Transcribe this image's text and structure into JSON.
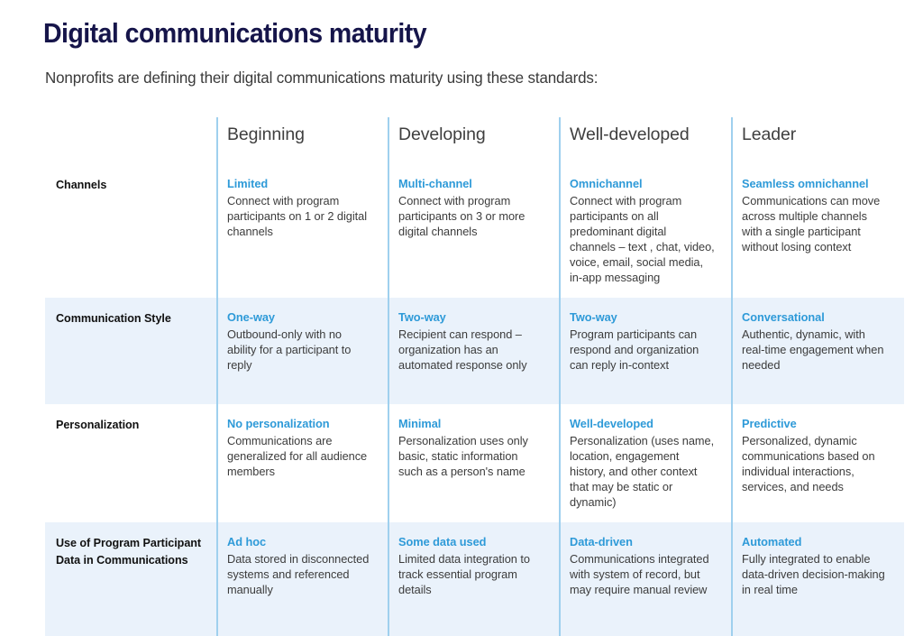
{
  "page": {
    "title": "Digital communications maturity",
    "subtitle": "Nonprofits are defining their digital communications maturity using these standards:",
    "colors": {
      "title_navy": "#16154a",
      "accent_blue": "#2e9ad8",
      "divider_blue": "#9fd0ee",
      "shaded_row_bg": "#eaf2fb",
      "body_text": "#3c3c3c"
    }
  },
  "table": {
    "corner_header": "",
    "columns": [
      {
        "label": "Beginning"
      },
      {
        "label": "Developing"
      },
      {
        "label": "Well-developed"
      },
      {
        "label": "Leader"
      }
    ],
    "rows": [
      {
        "label": "Channels",
        "shaded": false,
        "cells": [
          {
            "title": "Limited",
            "body": "Connect with program participants on 1 or 2 digital channels"
          },
          {
            "title": "Multi-channel",
            "body": "Connect with program participants on 3 or more digital channels"
          },
          {
            "title": "Omnichannel",
            "body": "Connect with program participants on all predominant digital channels – text , chat, video, voice, email, social media, in-app messaging"
          },
          {
            "title": "Seamless omnichannel",
            "body": "Communications can move across multiple channels with a single participant without losing context"
          }
        ]
      },
      {
        "label": "Communication Style",
        "shaded": true,
        "cells": [
          {
            "title": "One-way",
            "body": "Outbound-only with no ability for a participant to reply"
          },
          {
            "title": "Two-way",
            "body": "Recipient can respond – organization has an automated response only"
          },
          {
            "title": "Two-way",
            "body": "Program participants can respond and organization can reply in-context"
          },
          {
            "title": "Conversational",
            "body": "Authentic, dynamic, with real-time engagement when needed"
          }
        ]
      },
      {
        "label": "Personalization",
        "shaded": false,
        "cells": [
          {
            "title": "No personalization",
            "body": "Communications are generalized for all audience members"
          },
          {
            "title": "Minimal",
            "body": "Personalization uses only basic, static information such as a person's name"
          },
          {
            "title": "Well-developed",
            "body": "Personalization (uses name, location, engagement history, and other context that may be static or dynamic)"
          },
          {
            "title": "Predictive",
            "body": "Personalized, dynamic communications based on individual interactions, services, and needs"
          }
        ]
      },
      {
        "label": "Use of Program Participant Data in Communications",
        "shaded": true,
        "cells": [
          {
            "title": "Ad hoc",
            "body": "Data stored in disconnected systems and referenced manually"
          },
          {
            "title": "Some data used",
            "body": "Limited data integration to track essential program details"
          },
          {
            "title": "Data-driven",
            "body": "Communications integrated with system of record, but may require manual review"
          },
          {
            "title": "Automated",
            "body": "Fully integrated to enable data-driven decision-making in real time"
          }
        ]
      }
    ]
  }
}
